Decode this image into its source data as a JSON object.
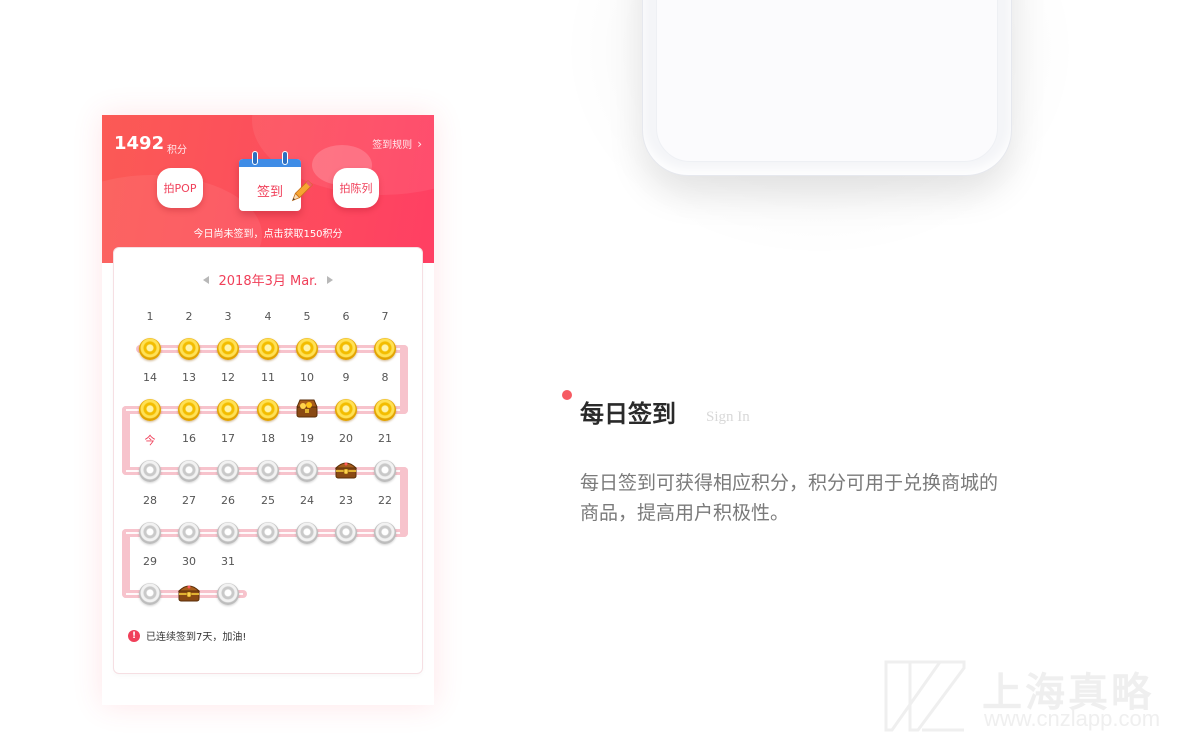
{
  "header": {
    "points_value": "1492",
    "points_unit": "积分",
    "rules_link": "签到规则",
    "left_button": "拍POP",
    "sign_in_button": "签到",
    "right_button": "拍陈列",
    "status_text": "今日尚未签到，点击获取150积分"
  },
  "calendar": {
    "month_label": "2018年3月 Mar.",
    "rows": [
      {
        "days": [
          "1",
          "2",
          "3",
          "4",
          "5",
          "6",
          "7"
        ],
        "items": [
          "gold",
          "gold",
          "gold",
          "gold",
          "gold",
          "gold",
          "gold"
        ]
      },
      {
        "days": [
          "14",
          "13",
          "12",
          "11",
          "10",
          "9",
          "8"
        ],
        "items": [
          "gold",
          "gold",
          "gold",
          "gold",
          "chest-open",
          "gold",
          "gold"
        ]
      },
      {
        "days": [
          "今",
          "16",
          "17",
          "18",
          "19",
          "20",
          "21"
        ],
        "items": [
          "silver",
          "silver",
          "silver",
          "silver",
          "silver",
          "chest",
          "silver"
        ]
      },
      {
        "days": [
          "28",
          "27",
          "26",
          "25",
          "24",
          "23",
          "22"
        ],
        "items": [
          "silver",
          "silver",
          "silver",
          "silver",
          "silver",
          "silver",
          "silver"
        ]
      },
      {
        "days": [
          "29",
          "30",
          "31"
        ],
        "items": [
          "silver",
          "chest",
          "silver"
        ]
      }
    ],
    "streak_text": "已连续签到7天，加油!"
  },
  "feature": {
    "title": "每日签到",
    "subtitle": "Sign In",
    "description": "每日签到可获得相应积分，积分可用于兑换商城的商品，提高用户积极性。"
  },
  "watermark": {
    "name": "上海真略",
    "url": "www.cnzlapp.com"
  },
  "colors": {
    "brand": "#f0405a",
    "header_gradient_start": "#fb5a55",
    "header_gradient_end": "#ff3f63",
    "track": "#f7c3cc"
  }
}
